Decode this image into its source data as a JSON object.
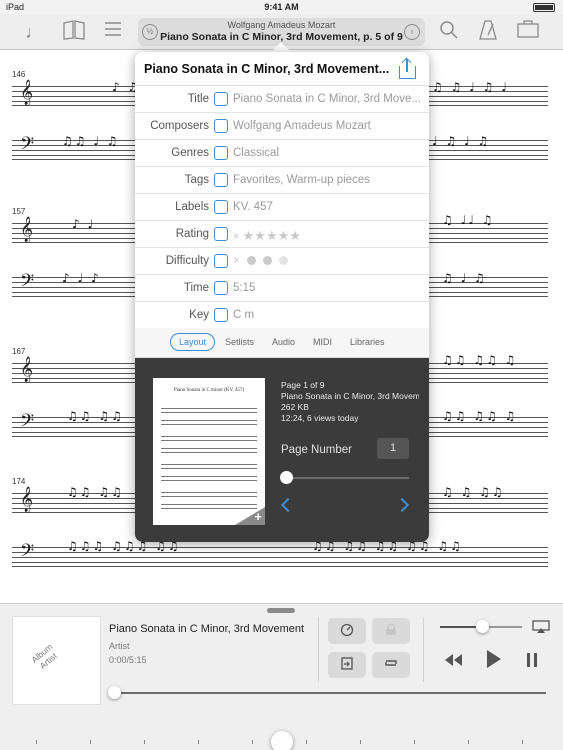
{
  "status_bar": {
    "carrier": "iPad",
    "time": "9:41 AM"
  },
  "toolbar": {
    "composer": "Wolfgang Amadeus Mozart",
    "title": "Piano Sonata in C Minor, 3rd Movement, p. 5 of 9",
    "half_label": "½",
    "icons": [
      "note-icon",
      "library-book-icon",
      "menu-icon",
      "half-page-icon",
      "next-page-icon",
      "search-icon",
      "metronome-icon",
      "briefcase-icon"
    ]
  },
  "score": {
    "measure_numbers": [
      "146",
      "157",
      "167",
      "174"
    ]
  },
  "popover": {
    "header_title": "Piano Sonata in C Minor, 3rd Movement...",
    "rows": [
      {
        "label": "Title",
        "value": "Piano Sonata in C Minor, 3rd Move..."
      },
      {
        "label": "Composers",
        "value": "Wolfgang Amadeus Mozart"
      },
      {
        "label": "Genres",
        "value": "Classical"
      },
      {
        "label": "Tags",
        "value": "Favorites, Warm-up pieces"
      },
      {
        "label": "Labels",
        "value": "KV. 457"
      },
      {
        "label": "Rating",
        "value": ""
      },
      {
        "label": "Difficulty",
        "value": ""
      },
      {
        "label": "Time",
        "value": "5:15"
      },
      {
        "label": "Key",
        "value": "C m"
      }
    ],
    "rating_clear": "×",
    "rating_stars": "★★★★★",
    "difficulty_clear": "×",
    "tabs": [
      "Layout",
      "Setlists",
      "Audio",
      "MIDI",
      "Libraries"
    ],
    "active_tab": "Layout",
    "page_info": {
      "line1": "Page 1 of 9",
      "line2": "Piano Sonata in C Minor, 3rd Movement",
      "line3": "262 KB",
      "line4": "12:24, 6 views today"
    },
    "thumb_title": "Piano Sonata in C minor (KV. 457)",
    "thumb_plus": "+",
    "page_number_label": "Page Number",
    "page_number_value": "1"
  },
  "player": {
    "album_line1": "Album",
    "album_line2": "Artist",
    "song_title": "Piano Sonata in C Minor, 3rd Movement",
    "artist": "Artist",
    "time": "0:00/5:15",
    "volume_level": 0.52,
    "progress": 0.0
  },
  "colors": {
    "accent": "#3a8fd6",
    "panel_dark": "#3b3b3b"
  }
}
